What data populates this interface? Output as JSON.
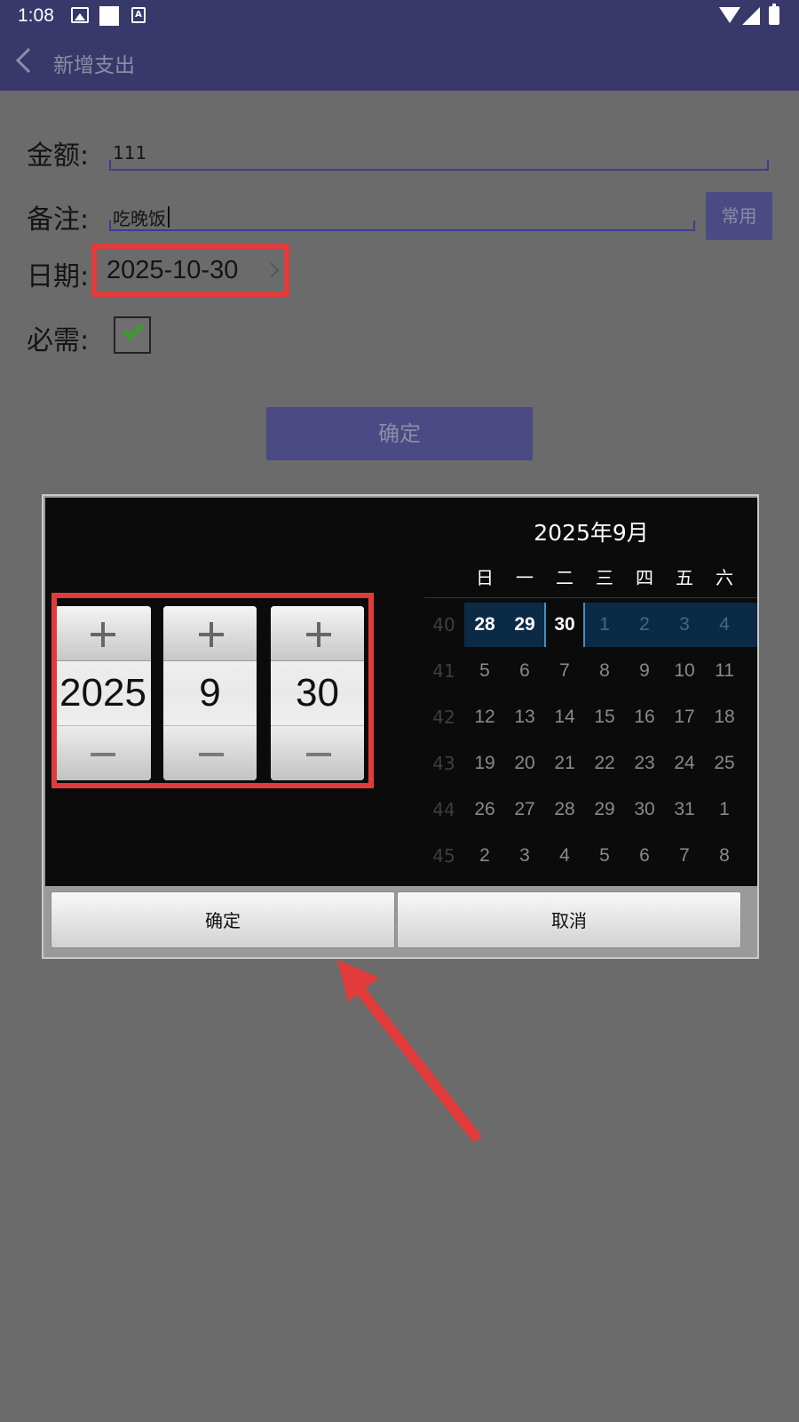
{
  "status_bar": {
    "time": "1:08"
  },
  "app_bar": {
    "title": "新增支出"
  },
  "form": {
    "amount_label": "金额:",
    "amount_value": "111",
    "note_label": "备注:",
    "note_value": "吃晚饭",
    "common_button": "常用",
    "date_label": "日期:",
    "date_value": "2025-10-30",
    "required_label": "必需:",
    "required_checked": true,
    "confirm_button": "确定"
  },
  "dialog": {
    "spinners": {
      "year": "2025",
      "month": "9",
      "day": "30"
    },
    "calendar": {
      "title": "2025年9月",
      "weekdays": [
        "日",
        "一",
        "二",
        "三",
        "四",
        "五",
        "六"
      ],
      "weeks": [
        {
          "num": "40",
          "days": [
            "28",
            "29",
            "30",
            "1",
            "2",
            "3",
            "4"
          ]
        },
        {
          "num": "41",
          "days": [
            "5",
            "6",
            "7",
            "8",
            "9",
            "10",
            "11"
          ]
        },
        {
          "num": "42",
          "days": [
            "12",
            "13",
            "14",
            "15",
            "16",
            "17",
            "18"
          ]
        },
        {
          "num": "43",
          "days": [
            "19",
            "20",
            "21",
            "22",
            "23",
            "24",
            "25"
          ]
        },
        {
          "num": "44",
          "days": [
            "26",
            "27",
            "28",
            "29",
            "30",
            "31",
            "1"
          ]
        },
        {
          "num": "45",
          "days": [
            "2",
            "3",
            "4",
            "5",
            "6",
            "7",
            "8"
          ]
        }
      ],
      "selected_day": "30"
    },
    "ok_button": "确定",
    "cancel_button": "取消"
  },
  "colors": {
    "app_bar": "#39386b",
    "annotation_red": "#e23b3b",
    "selected_week": "#0b2a45"
  }
}
